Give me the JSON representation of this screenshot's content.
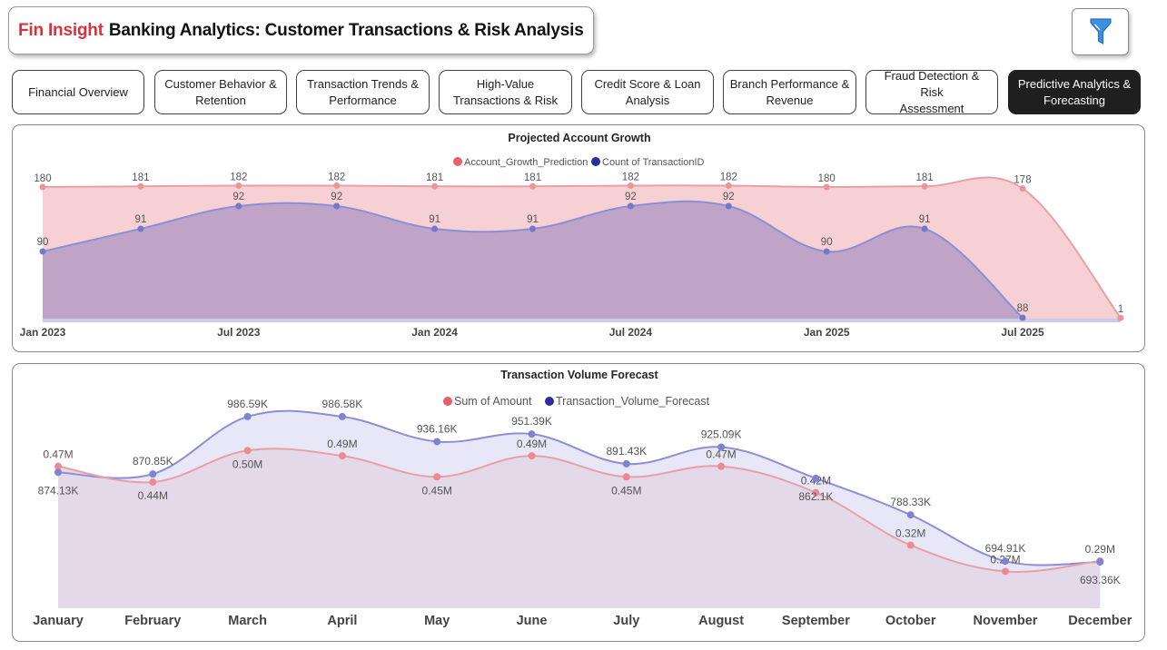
{
  "header": {
    "brand": "Fin Insight",
    "title": "Banking Analytics: Customer Transactions & Risk Analysis",
    "filter_icon": "funnel-icon"
  },
  "tabs": [
    {
      "label": "Financial Overview",
      "active": false
    },
    {
      "label": "Customer Behavior &\nRetention",
      "active": false
    },
    {
      "label": "Transaction Trends &\nPerformance",
      "active": false
    },
    {
      "label": "High-Value\nTransactions & Risk",
      "active": false
    },
    {
      "label": "Credit Score & Loan\nAnalysis",
      "active": false
    },
    {
      "label": "Branch Performance &\nRevenue",
      "active": false
    },
    {
      "label": "Fraud Detection & Risk\nAssessment",
      "active": false
    },
    {
      "label": "Predictive Analytics &\nForecasting",
      "active": true
    }
  ],
  "colors": {
    "pink": "#e8606a",
    "blue": "#2a2ea0",
    "pink_line": "#e9a0a5",
    "blue_line": "#8b8fd6"
  },
  "chart_data": [
    {
      "type": "area",
      "title": "Projected Account Growth",
      "x_tick_labels": [
        "Jan 2023",
        "Jul 2023",
        "Jan 2024",
        "Jul 2024",
        "Jan 2025",
        "Jul 2025"
      ],
      "x": [
        "2023-01",
        "2023-04",
        "2023-07",
        "2023-10",
        "2024-01",
        "2024-04",
        "2024-07",
        "2024-10",
        "2025-01",
        "2025-04",
        "2025-07",
        "2025-10"
      ],
      "series": [
        {
          "name": "Account_Growth_Prediction",
          "values": [
            180,
            181,
            182,
            182,
            181,
            181,
            182,
            182,
            180,
            181,
            178,
            1
          ],
          "labels": [
            "180",
            "181",
            "182",
            "182",
            "181",
            "181",
            "182",
            "182",
            "180",
            "181",
            "178",
            "1"
          ]
        },
        {
          "name": "Count of TransactionID",
          "values": [
            90,
            91,
            92,
            92,
            91,
            91,
            92,
            92,
            90,
            91,
            88,
            null
          ],
          "labels": [
            "90",
            "91",
            "92",
            "92",
            "91",
            "91",
            "92",
            "92",
            "90",
            "91",
            "88",
            ""
          ]
        }
      ],
      "ylim": [
        0,
        190
      ],
      "legend_position": "top-center"
    },
    {
      "type": "area",
      "title": "Transaction Volume Forecast",
      "categories": [
        "January",
        "February",
        "March",
        "April",
        "May",
        "June",
        "July",
        "August",
        "September",
        "October",
        "November",
        "December"
      ],
      "series": [
        {
          "name": "Sum of Amount",
          "values": [
            0.47,
            0.44,
            0.5,
            0.49,
            0.45,
            0.49,
            0.45,
            0.47,
            0.42,
            0.32,
            0.27,
            0.29
          ],
          "labels": [
            "0.47M",
            "0.44M",
            "0.50M",
            "0.49M",
            "0.45M",
            "0.49M",
            "0.45M",
            "0.47M",
            "0.42M",
            "0.32M",
            "0.27M",
            "0.29M"
          ],
          "unit": "M"
        },
        {
          "name": "Transaction_Volume_Forecast",
          "values": [
            874.13,
            870.85,
            986.59,
            986.58,
            936.16,
            951.39,
            891.43,
            925.09,
            862.1,
            788.33,
            694.91,
            693.36
          ],
          "labels": [
            "874.13K",
            "870.85K",
            "986.59K",
            "986.58K",
            "936.16K",
            "951.39K",
            "891.43K",
            "925.09K",
            "862.1K",
            "788.33K",
            "694.91K",
            "693.36K"
          ],
          "unit": "K"
        }
      ],
      "legend_position": "top-center"
    }
  ]
}
